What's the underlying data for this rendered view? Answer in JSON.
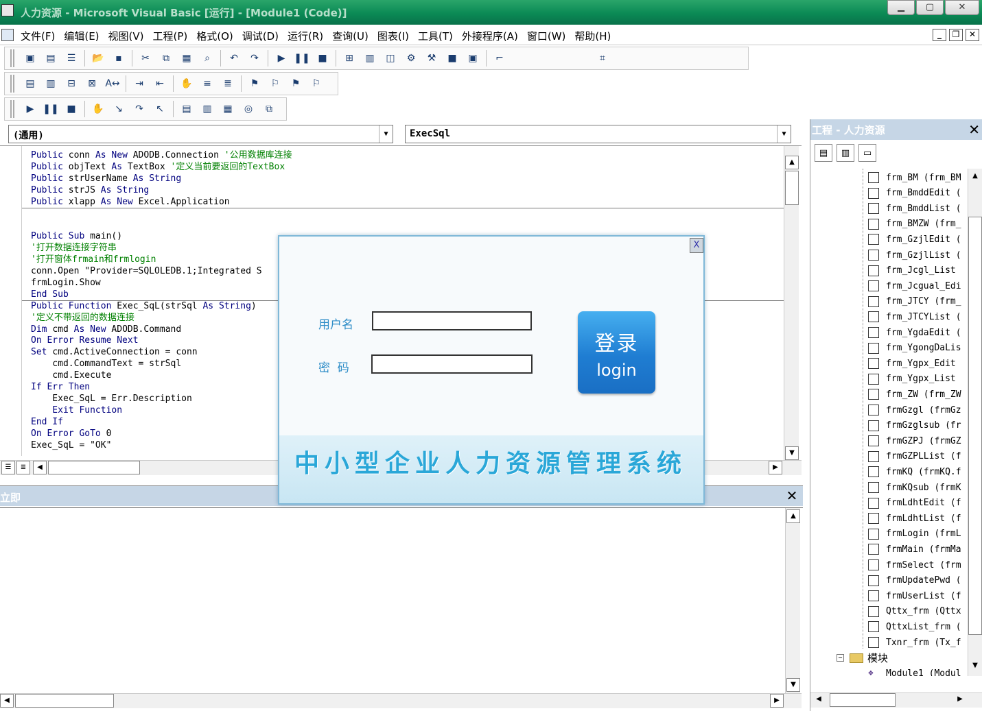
{
  "window": {
    "title": "人力资源 - Microsoft Visual Basic [运行] - [Module1 (Code)]",
    "min": "▁",
    "max": "▢",
    "close": "✕"
  },
  "menu": {
    "items": [
      "文件(F)",
      "编辑(E)",
      "视图(V)",
      "工程(P)",
      "格式(O)",
      "调试(D)",
      "运行(R)",
      "查询(U)",
      "图表(I)",
      "工具(T)",
      "外接程序(A)",
      "窗口(W)",
      "帮助(H)"
    ],
    "mdi_min": "_",
    "mdi_restore": "❐",
    "mdi_close": "✕"
  },
  "code_window": {
    "object_combo": "(通用)",
    "proc_combo": "ExecSql",
    "lines": [
      [
        {
          "t": "Public ",
          "c": "kw"
        },
        {
          "t": "conn ",
          "c": ""
        },
        {
          "t": "As New ",
          "c": "kw"
        },
        {
          "t": "ADODB.Connection ",
          "c": ""
        },
        {
          "t": "'公用数据库连接",
          "c": "cm"
        }
      ],
      [
        {
          "t": "Public ",
          "c": "kw"
        },
        {
          "t": "objText ",
          "c": ""
        },
        {
          "t": "As ",
          "c": "kw"
        },
        {
          "t": "TextBox ",
          "c": ""
        },
        {
          "t": "'定义当前要返回的TextBox",
          "c": "cm"
        }
      ],
      [
        {
          "t": "Public ",
          "c": "kw"
        },
        {
          "t": "strUserName ",
          "c": ""
        },
        {
          "t": "As String",
          "c": "kw"
        }
      ],
      [
        {
          "t": "Public ",
          "c": "kw"
        },
        {
          "t": "strJS ",
          "c": ""
        },
        {
          "t": "As String",
          "c": "kw"
        }
      ],
      [
        {
          "t": "Public ",
          "c": "kw"
        },
        {
          "t": "xlapp ",
          "c": ""
        },
        {
          "t": "As New ",
          "c": "kw"
        },
        {
          "t": "Excel.Application",
          "c": ""
        }
      ],
      [
        {
          "t": "",
          "c": ""
        }
      ],
      [
        {
          "t": "",
          "c": ""
        }
      ],
      [
        {
          "t": "Public Sub ",
          "c": "kw"
        },
        {
          "t": "main()",
          "c": ""
        }
      ],
      [
        {
          "t": "'打开数据连接字符串",
          "c": "cm"
        }
      ],
      [
        {
          "t": "'打开窗体frmain和frmlogin",
          "c": "cm"
        }
      ],
      [
        {
          "t": "conn.Open \"Provider=SQLOLEDB.1;Integrated S",
          "c": ""
        }
      ],
      [
        {
          "t": "frmLogin.Show",
          "c": ""
        }
      ],
      [
        {
          "t": "End Sub",
          "c": "kw"
        }
      ],
      [
        {
          "t": "Public Function ",
          "c": "kw"
        },
        {
          "t": "Exec_SqL(strSql ",
          "c": ""
        },
        {
          "t": "As String",
          "c": "kw"
        },
        {
          "t": ")",
          "c": ""
        }
      ],
      [
        {
          "t": "'定义不带返回的数据连接",
          "c": "cm"
        }
      ],
      [
        {
          "t": "Dim ",
          "c": "kw"
        },
        {
          "t": "cmd ",
          "c": ""
        },
        {
          "t": "As New ",
          "c": "kw"
        },
        {
          "t": "ADODB.Command",
          "c": ""
        }
      ],
      [
        {
          "t": "On Error Resume Next",
          "c": "kw"
        }
      ],
      [
        {
          "t": "Set ",
          "c": "kw"
        },
        {
          "t": "cmd.ActiveConnection = conn",
          "c": ""
        }
      ],
      [
        {
          "t": "    cmd.CommandText = strSql",
          "c": ""
        }
      ],
      [
        {
          "t": "    cmd.Execute",
          "c": ""
        }
      ],
      [
        {
          "t": "If Err Then",
          "c": "kw"
        }
      ],
      [
        {
          "t": "    Exec_SqL = Err.Description",
          "c": ""
        }
      ],
      [
        {
          "t": "    Exit Function",
          "c": "kw"
        }
      ],
      [
        {
          "t": "End If",
          "c": "kw"
        }
      ],
      [
        {
          "t": "On Error GoTo ",
          "c": "kw"
        },
        {
          "t": "0",
          "c": ""
        }
      ],
      [
        {
          "t": "Exec_SqL = \"OK\"",
          "c": ""
        }
      ]
    ]
  },
  "immediate": {
    "title": "立即",
    "close": "✕"
  },
  "project": {
    "title": "工程 - 人力资源",
    "close": "✕",
    "forms": [
      "frm_BM (frm_BM",
      "frm_BmddEdit (",
      "frm_BmddList (",
      "frm_BMZW (frm_",
      "frm_GzjlEdit (",
      "frm_GzjlList (",
      "frm_Jcgl_List",
      "frm_Jcgual_Edi",
      "frm_JTCY (frm_",
      "frm_JTCYList (",
      "frm_YgdaEdit (",
      "frm_YgongDaLis",
      "frm_Ygpx_Edit",
      "frm_Ygpx_List",
      "frm_ZW (frm_ZW",
      "frmGzgl (frmGz",
      "frmGzglsub (fr",
      "frmGZPJ (frmGZ",
      "frmGZPLList (f",
      "frmKQ (frmKQ.f",
      "frmKQsub (frmK",
      "frmLdhtEdit (f",
      "frmLdhtList (f",
      "frmLogin (frmL",
      "frmMain (frmMa",
      "frmSelect (frm",
      "frmUpdatePwd (",
      "frmUserList (f",
      "Qttx_frm (Qttx",
      "QttxList_frm (",
      "Txnr_frm (Tx_f"
    ],
    "modules_folder": "模块",
    "modules": [
      "Module1 (Modul"
    ]
  },
  "login_dialog": {
    "close": "X",
    "username_label": "用户名",
    "password_label": "密  码",
    "username_value": "",
    "password_value": "",
    "login_cn": "登录",
    "login_en": "login",
    "banner": "中小型企业人力资源管理系统"
  }
}
